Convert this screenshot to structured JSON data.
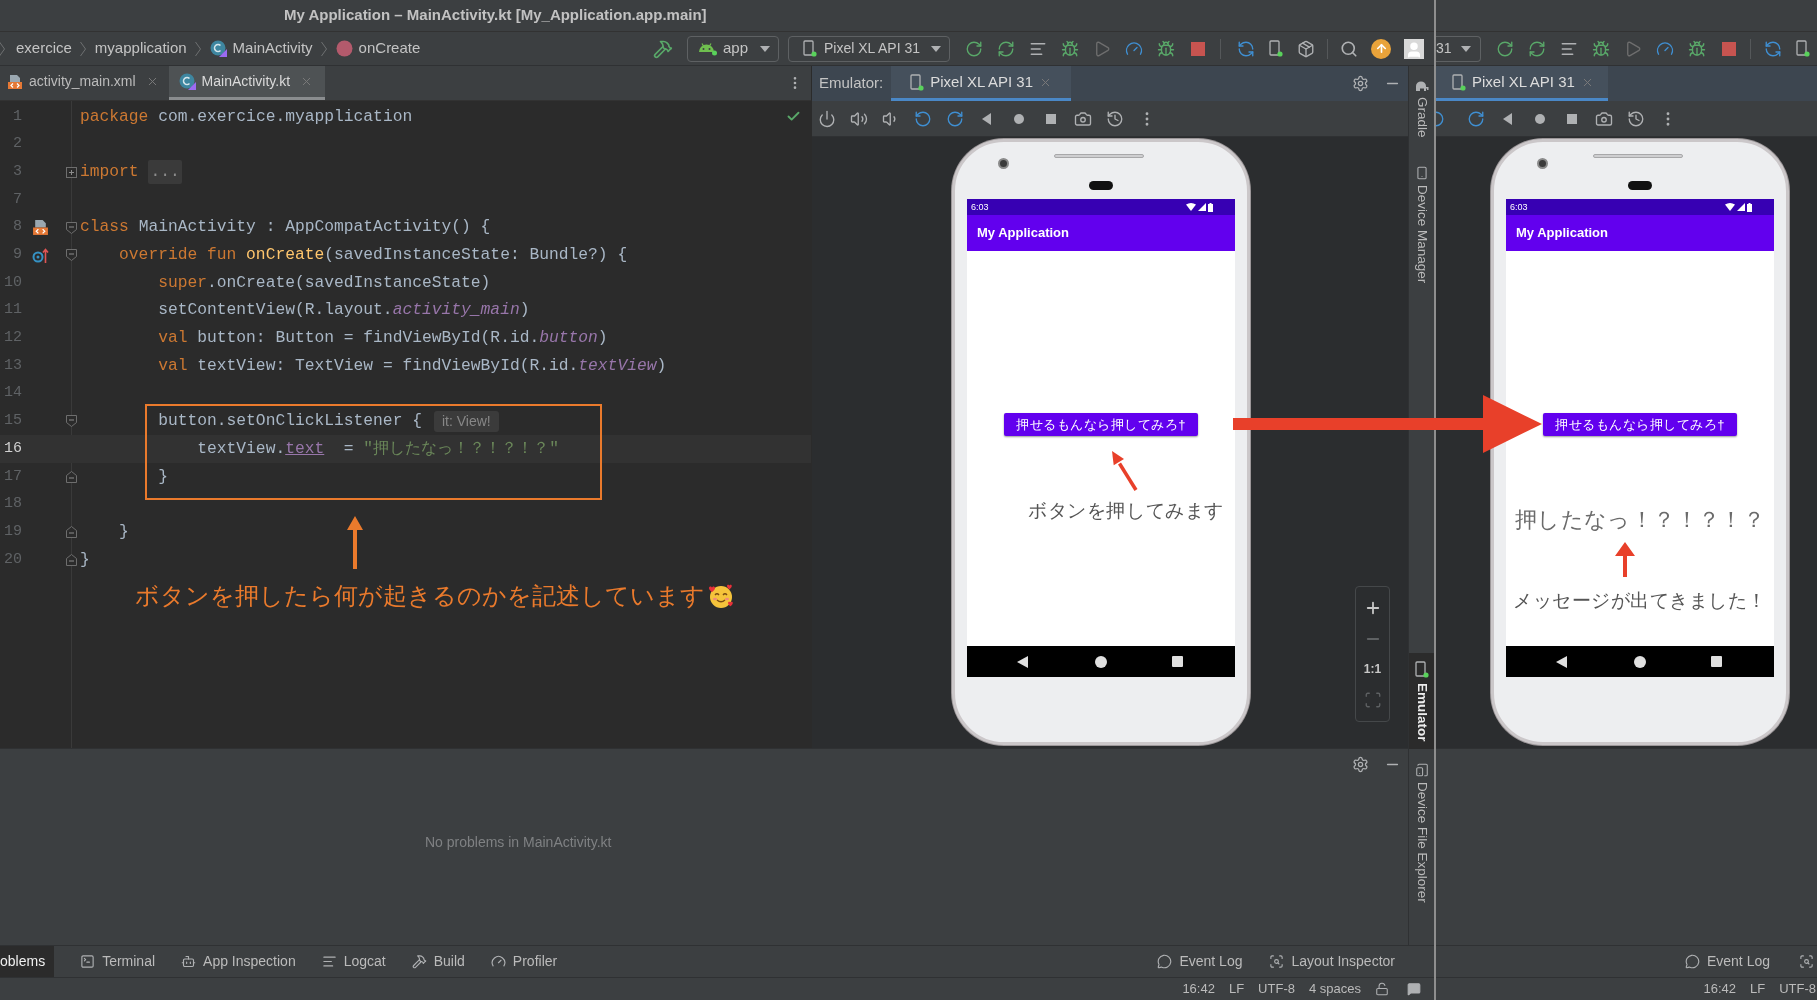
{
  "window": {
    "title": "My Application – MainActivity.kt [My_Application.app.main]"
  },
  "breadcrumb": [
    {
      "label": "exercice",
      "kind": "folder"
    },
    {
      "label": "myapplication",
      "kind": "folder"
    },
    {
      "label": "MainActivity",
      "kind": "class"
    },
    {
      "label": "onCreate",
      "kind": "method"
    }
  ],
  "toolbar": {
    "run_config": "app",
    "device": "Pixel XL API 31"
  },
  "editor": {
    "tabs": [
      {
        "label": "activity_main.xml",
        "kind": "xml",
        "selected": false
      },
      {
        "label": "MainActivity.kt",
        "kind": "kotlin",
        "selected": true
      }
    ],
    "lines": [
      {
        "number": "1",
        "current": false,
        "tokens": [
          {
            "text": "package",
            "kind": "keyword"
          },
          {
            "text": " com.exercice.myapplication",
            "kind": "plain"
          }
        ]
      },
      {
        "number": "2",
        "current": false
      },
      {
        "number": "3",
        "current": false,
        "fold": {
          "kind": "collapsed"
        },
        "tokens": [
          {
            "text": "import",
            "kind": "keyword"
          },
          {
            "text": "...",
            "kind": "folded"
          }
        ]
      },
      {
        "number": "7",
        "current": false
      },
      {
        "number": "8",
        "current": false,
        "gutter": {
          "kind": "layout"
        },
        "fold": {
          "kind": "start"
        },
        "tokens": [
          {
            "text": "class",
            "kind": "keyword"
          },
          {
            "text": " MainActivity : AppCompatActivity() {",
            "kind": "plain"
          }
        ]
      },
      {
        "number": "9",
        "current": false,
        "gutter": {
          "kind": "override"
        },
        "fold": {
          "kind": "start"
        },
        "tokens": [
          {
            "text": "    override fun ",
            "kind": "keyword"
          },
          {
            "text": "onCreate",
            "kind": "function"
          },
          {
            "text": "(savedInstanceState: Bundle?) {",
            "kind": "plain"
          }
        ]
      },
      {
        "number": "10",
        "current": false,
        "tokens": [
          {
            "text": "        super",
            "kind": "keyword"
          },
          {
            "text": ".onCreate(savedInstanceState)",
            "kind": "plain"
          }
        ]
      },
      {
        "number": "11",
        "current": false,
        "tokens": [
          {
            "text": "        setContentView(R.layout.",
            "kind": "plain"
          },
          {
            "text": "activity_main",
            "kind": "field"
          },
          {
            "text": ")",
            "kind": "plain"
          }
        ]
      },
      {
        "number": "12",
        "current": false,
        "tokens": [
          {
            "text": "        val ",
            "kind": "keyword"
          },
          {
            "text": "button: Button = findViewById(R.id.",
            "kind": "plain"
          },
          {
            "text": "button",
            "kind": "field"
          },
          {
            "text": ")",
            "kind": "plain"
          }
        ]
      },
      {
        "number": "13",
        "current": false,
        "tokens": [
          {
            "text": "        val ",
            "kind": "keyword"
          },
          {
            "text": "textView: TextView = findViewById(R.id.",
            "kind": "plain"
          },
          {
            "text": "textView",
            "kind": "field"
          },
          {
            "text": ")",
            "kind": "plain"
          }
        ]
      },
      {
        "number": "14",
        "current": false
      },
      {
        "number": "15",
        "current": false,
        "fold": {
          "kind": "start"
        },
        "tokens": [
          {
            "text": "        button.setOnClickListener {",
            "kind": "plain"
          },
          {
            "text": "it: View!",
            "kind": "hint"
          }
        ]
      },
      {
        "number": "16",
        "current": true,
        "tokens": [
          {
            "text": "            textView.",
            "kind": "plain"
          },
          {
            "text": "text",
            "kind": "property"
          },
          {
            "text": "  = ",
            "kind": "plain"
          },
          {
            "text": "\"押したなっ！？！？！？\"",
            "kind": "string"
          }
        ]
      },
      {
        "number": "17",
        "current": false,
        "fold": {
          "kind": "end"
        },
        "tokens": [
          {
            "text": "        }",
            "kind": "plain"
          }
        ]
      },
      {
        "number": "18",
        "current": false
      },
      {
        "number": "19",
        "current": false,
        "fold": {
          "kind": "end"
        },
        "tokens": [
          {
            "text": "    }",
            "kind": "plain"
          }
        ]
      },
      {
        "number": "20",
        "current": false,
        "fold": {
          "kind": "end"
        },
        "tokens": [
          {
            "text": "}",
            "kind": "plain"
          }
        ]
      }
    ]
  },
  "annotation": {
    "text": "ボタンを押したら何が起きるのかを記述しています"
  },
  "emulator": {
    "label": "Emulator:",
    "tabs": [
      {
        "label": "Pixel XL API 31",
        "selected": true
      }
    ],
    "zoom_label": "1:1",
    "phone": {
      "status_time": "6:03",
      "app_title": "My Application",
      "button_label": "押せるもんなら押してみろ†",
      "note": "ボタンを押してみます"
    }
  },
  "problems": {
    "message": "No problems in MainActivity.kt"
  },
  "side_tools": [
    {
      "label": "Gradle",
      "kind": "gradle",
      "selected": false
    },
    {
      "label": "Device Manager",
      "kind": "device",
      "selected": false
    },
    {
      "label": "Emulator",
      "kind": "emulator",
      "selected": true
    },
    {
      "label": "Device File Explorer",
      "kind": "files",
      "selected": false
    }
  ],
  "tool_windows": [
    {
      "label": "oblems",
      "kind": "problems",
      "selected": true
    },
    {
      "label": "Terminal",
      "kind": "terminal",
      "selected": false
    },
    {
      "label": "App Inspection",
      "kind": "inspection",
      "selected": false
    },
    {
      "label": "Logcat",
      "kind": "logcat",
      "selected": false
    },
    {
      "label": "Build",
      "kind": "build",
      "selected": false
    },
    {
      "label": "Profiler",
      "kind": "profiler",
      "selected": false
    }
  ],
  "tool_windows_right": [
    {
      "label": "Event Log",
      "kind": "log",
      "selected": false
    },
    {
      "label": "Layout Inspector",
      "kind": "inspector",
      "selected": false
    }
  ],
  "status_bar": [
    "16:42",
    "LF",
    "UTF-8",
    "4 spaces"
  ],
  "after_screenshot": {
    "device_fragment": "31",
    "tabs": [
      {
        "label": "Pixel XL API 31",
        "selected": true
      }
    ],
    "phone": {
      "status_time": "6:03",
      "app_title": "My Application",
      "button_label": "押せるもんなら押してみろ†",
      "message": "押したなっ！？！？！？",
      "note": "メッセージが出てきました！"
    },
    "tool_windows": [
      {
        "label": "Event Log",
        "kind": "log",
        "selected": false
      },
      {
        "kind": "inspector",
        "selected": false
      }
    ],
    "status_bar": [
      "16:42",
      "LF",
      "UTF-8"
    ]
  }
}
